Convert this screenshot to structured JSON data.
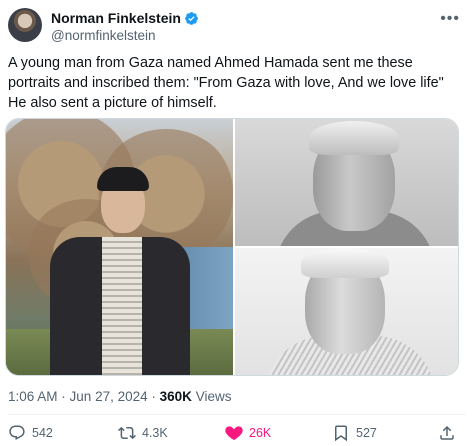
{
  "author": {
    "display_name": "Norman Finkelstein",
    "handle": "@normfinkelstein",
    "verified": true
  },
  "tweet": {
    "text": "A young man from Gaza named Ahmed Hamada sent me these portraits and inscribed them:  \"From Gaza with love, And we love life\" He also sent a picture of himself.",
    "time": "1:06 AM",
    "date": "Jun 27, 2024",
    "views_count": "360K",
    "views_label": "Views"
  },
  "media": [
    {
      "kind": "photo",
      "subject": "young-man-in-cap"
    },
    {
      "kind": "drawing",
      "subject": "pencil-portrait"
    },
    {
      "kind": "drawing",
      "subject": "pencil-portrait"
    }
  ],
  "actions": {
    "replies": "542",
    "reposts": "4.3K",
    "likes": "26K",
    "bookmarks": "527"
  },
  "colors": {
    "primary_text": "#0f1419",
    "secondary_text": "#536471",
    "verified_blue": "#1d9bf0",
    "like_pink": "#f91880",
    "border": "#cfd9de"
  },
  "icons": {
    "more": "more-icon",
    "reply": "reply-icon",
    "repost": "repost-icon",
    "like": "heart-icon",
    "bookmark": "bookmark-icon",
    "share": "share-icon"
  }
}
